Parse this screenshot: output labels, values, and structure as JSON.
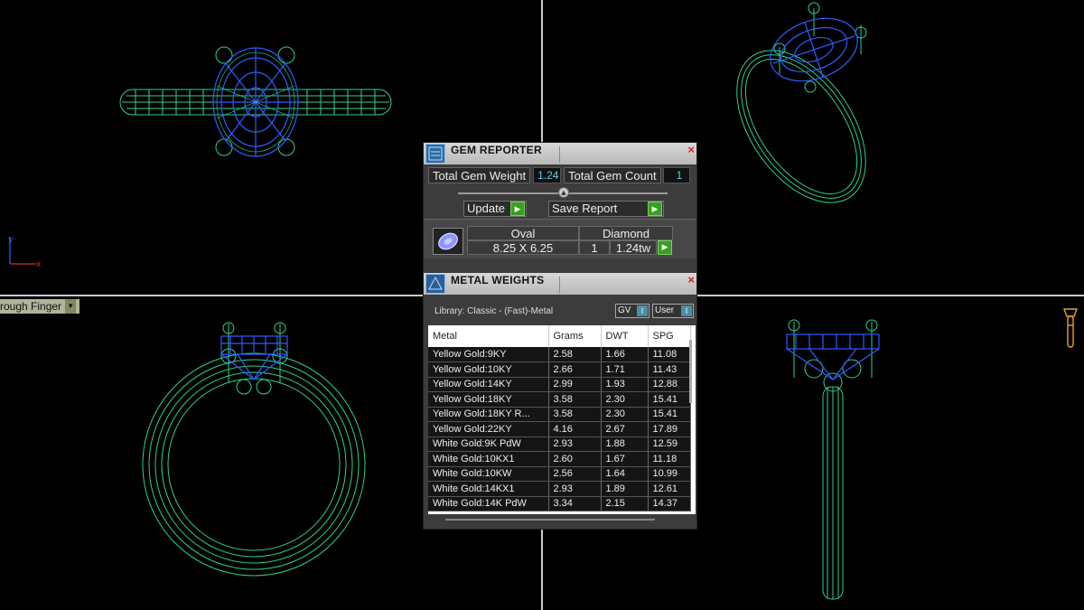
{
  "viewport": {
    "view_label": "rough Finger"
  },
  "gem_reporter": {
    "title": "GEM REPORTER",
    "total_weight_label": "Total Gem Weight",
    "total_weight_value": "1.24",
    "total_count_label": "Total Gem Count",
    "total_count_value": "1",
    "update_label": "Update",
    "save_report_label": "Save Report",
    "gem": {
      "shape": "Oval",
      "type": "Diamond",
      "size": "8.25 X 6.25",
      "qty": "1",
      "weight": "1.24tw"
    }
  },
  "metal_weights": {
    "title": "METAL WEIGHTS",
    "library": "Library: Classic - (Fast)-Metal",
    "toggle_gv": "GV",
    "toggle_user": "User",
    "columns": [
      "Metal",
      "Grams",
      "DWT",
      "SPG"
    ],
    "rows": [
      [
        "Yellow Gold:9KY",
        "2.58",
        "1.66",
        "11.08"
      ],
      [
        "Yellow Gold:10KY",
        "2.66",
        "1.71",
        "11.43"
      ],
      [
        "Yellow Gold:14KY",
        "2.99",
        "1.93",
        "12.88"
      ],
      [
        "Yellow Gold:18KY",
        "3.58",
        "2.30",
        "15.41"
      ],
      [
        "Yellow Gold:18KY R...",
        "3.58",
        "2.30",
        "15.41"
      ],
      [
        "Yellow Gold:22KY",
        "4.16",
        "2.67",
        "17.89"
      ],
      [
        "White Gold:9K PdW",
        "2.93",
        "1.88",
        "12.59"
      ],
      [
        "White Gold:10KX1",
        "2.60",
        "1.67",
        "11.18"
      ],
      [
        "White Gold:10KW",
        "2.56",
        "1.64",
        "10.99"
      ],
      [
        "White Gold:14KX1",
        "2.93",
        "1.89",
        "12.61"
      ],
      [
        "White Gold:14K PdW",
        "3.34",
        "2.15",
        "14.37"
      ]
    ]
  },
  "colors": {
    "wire_green": "#2fd08a",
    "wire_blue": "#2f5bff",
    "gold_icon": "#e8a21e"
  }
}
